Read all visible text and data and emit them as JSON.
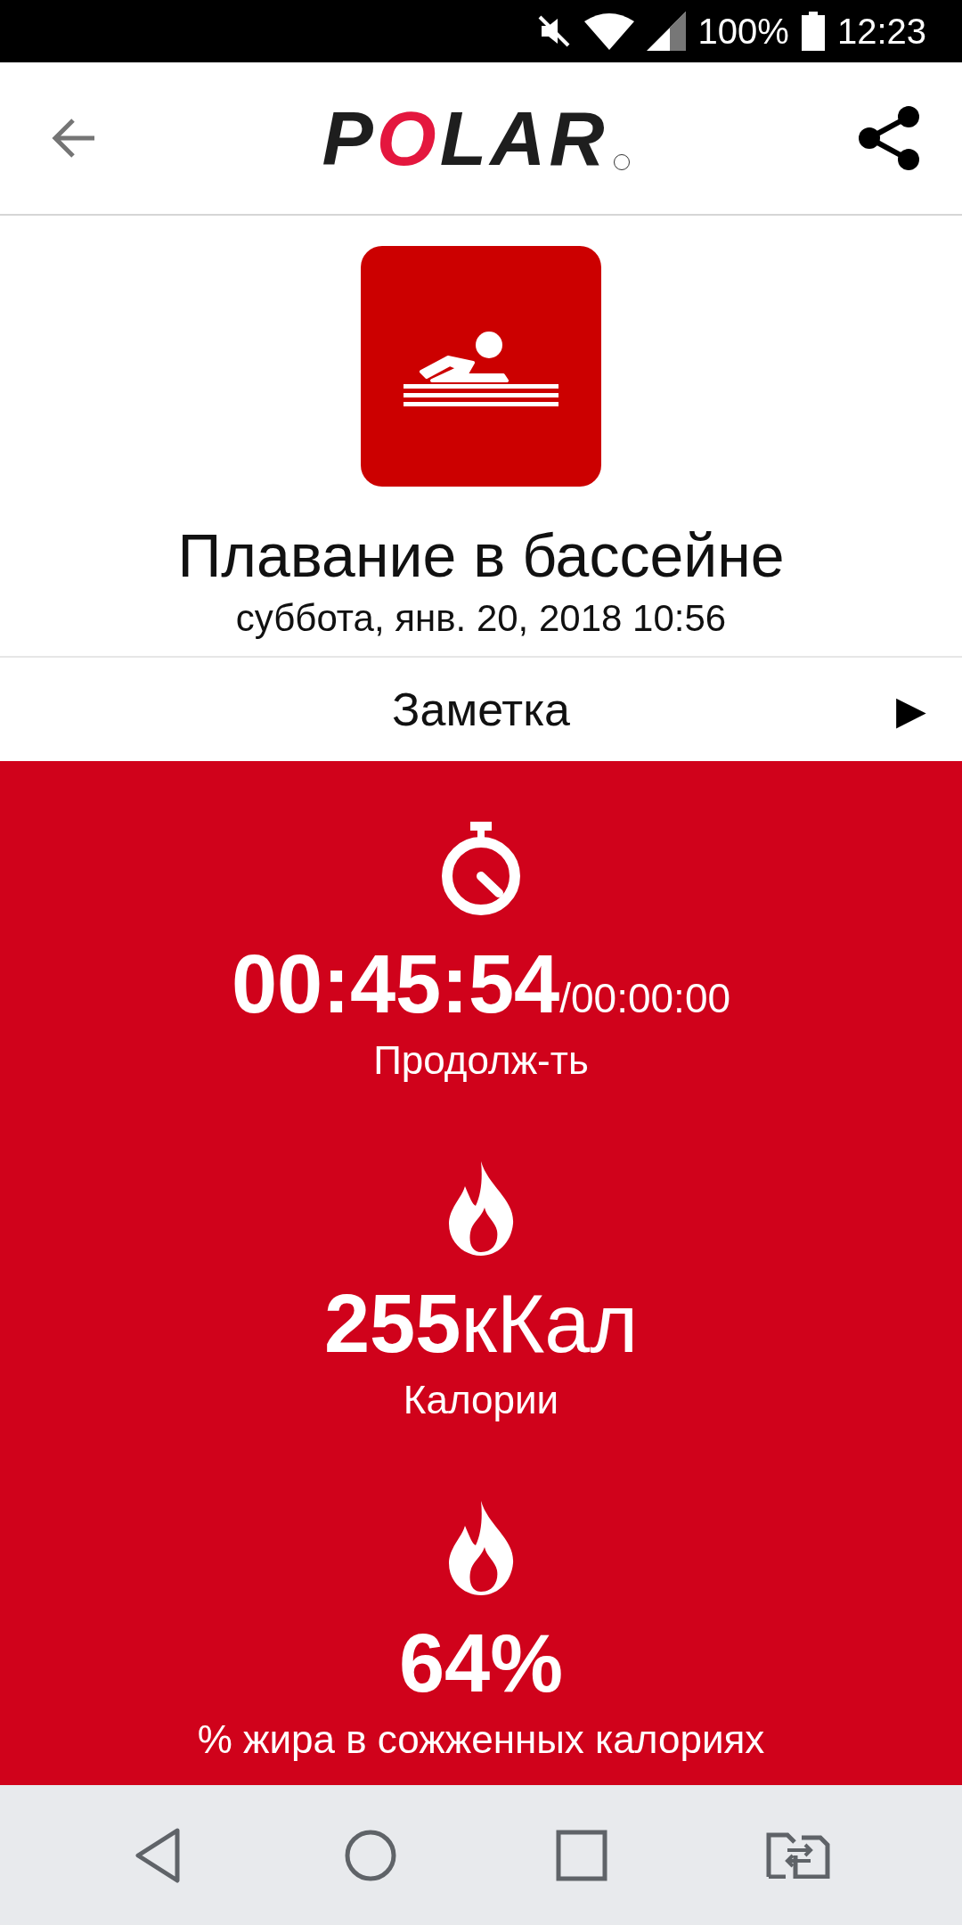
{
  "status_bar": {
    "battery": "100%",
    "time": "12:23"
  },
  "header": {
    "logo": "POLAR"
  },
  "activity": {
    "title": "Плавание в бассейне",
    "date": "суббота, янв. 20, 2018 10:56"
  },
  "note": {
    "label": "Заметка",
    "arrow": "▶"
  },
  "stats": [
    {
      "kind": "duration",
      "value": "00:45:54",
      "unit": "/00:00:00",
      "label": "Продолж-ть"
    },
    {
      "kind": "calories",
      "value": "255",
      "unit": "кКал",
      "label": "Калории"
    },
    {
      "kind": "fat",
      "value": "64%",
      "label": "% жира в сожженных калориях"
    }
  ]
}
